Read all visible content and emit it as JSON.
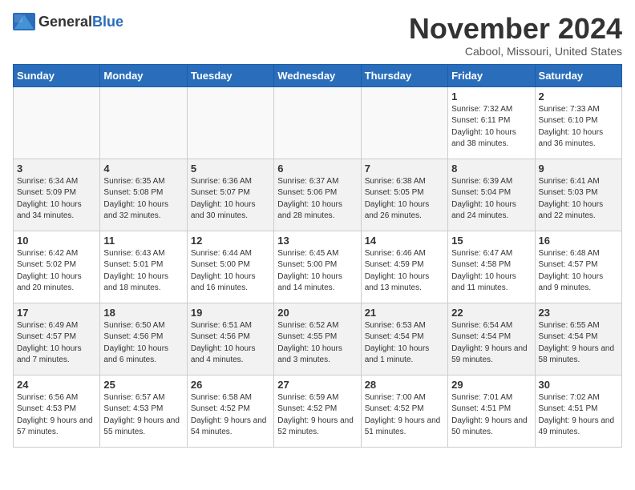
{
  "logo": {
    "text_general": "General",
    "text_blue": "Blue"
  },
  "header": {
    "month": "November 2024",
    "location": "Cabool, Missouri, United States"
  },
  "weekdays": [
    "Sunday",
    "Monday",
    "Tuesday",
    "Wednesday",
    "Thursday",
    "Friday",
    "Saturday"
  ],
  "weeks": [
    {
      "shaded": false,
      "days": [
        {
          "num": "",
          "info": ""
        },
        {
          "num": "",
          "info": ""
        },
        {
          "num": "",
          "info": ""
        },
        {
          "num": "",
          "info": ""
        },
        {
          "num": "",
          "info": ""
        },
        {
          "num": "1",
          "info": "Sunrise: 7:32 AM\nSunset: 6:11 PM\nDaylight: 10 hours and 38 minutes."
        },
        {
          "num": "2",
          "info": "Sunrise: 7:33 AM\nSunset: 6:10 PM\nDaylight: 10 hours and 36 minutes."
        }
      ]
    },
    {
      "shaded": true,
      "days": [
        {
          "num": "3",
          "info": "Sunrise: 6:34 AM\nSunset: 5:09 PM\nDaylight: 10 hours and 34 minutes."
        },
        {
          "num": "4",
          "info": "Sunrise: 6:35 AM\nSunset: 5:08 PM\nDaylight: 10 hours and 32 minutes."
        },
        {
          "num": "5",
          "info": "Sunrise: 6:36 AM\nSunset: 5:07 PM\nDaylight: 10 hours and 30 minutes."
        },
        {
          "num": "6",
          "info": "Sunrise: 6:37 AM\nSunset: 5:06 PM\nDaylight: 10 hours and 28 minutes."
        },
        {
          "num": "7",
          "info": "Sunrise: 6:38 AM\nSunset: 5:05 PM\nDaylight: 10 hours and 26 minutes."
        },
        {
          "num": "8",
          "info": "Sunrise: 6:39 AM\nSunset: 5:04 PM\nDaylight: 10 hours and 24 minutes."
        },
        {
          "num": "9",
          "info": "Sunrise: 6:41 AM\nSunset: 5:03 PM\nDaylight: 10 hours and 22 minutes."
        }
      ]
    },
    {
      "shaded": false,
      "days": [
        {
          "num": "10",
          "info": "Sunrise: 6:42 AM\nSunset: 5:02 PM\nDaylight: 10 hours and 20 minutes."
        },
        {
          "num": "11",
          "info": "Sunrise: 6:43 AM\nSunset: 5:01 PM\nDaylight: 10 hours and 18 minutes."
        },
        {
          "num": "12",
          "info": "Sunrise: 6:44 AM\nSunset: 5:00 PM\nDaylight: 10 hours and 16 minutes."
        },
        {
          "num": "13",
          "info": "Sunrise: 6:45 AM\nSunset: 5:00 PM\nDaylight: 10 hours and 14 minutes."
        },
        {
          "num": "14",
          "info": "Sunrise: 6:46 AM\nSunset: 4:59 PM\nDaylight: 10 hours and 13 minutes."
        },
        {
          "num": "15",
          "info": "Sunrise: 6:47 AM\nSunset: 4:58 PM\nDaylight: 10 hours and 11 minutes."
        },
        {
          "num": "16",
          "info": "Sunrise: 6:48 AM\nSunset: 4:57 PM\nDaylight: 10 hours and 9 minutes."
        }
      ]
    },
    {
      "shaded": true,
      "days": [
        {
          "num": "17",
          "info": "Sunrise: 6:49 AM\nSunset: 4:57 PM\nDaylight: 10 hours and 7 minutes."
        },
        {
          "num": "18",
          "info": "Sunrise: 6:50 AM\nSunset: 4:56 PM\nDaylight: 10 hours and 6 minutes."
        },
        {
          "num": "19",
          "info": "Sunrise: 6:51 AM\nSunset: 4:56 PM\nDaylight: 10 hours and 4 minutes."
        },
        {
          "num": "20",
          "info": "Sunrise: 6:52 AM\nSunset: 4:55 PM\nDaylight: 10 hours and 3 minutes."
        },
        {
          "num": "21",
          "info": "Sunrise: 6:53 AM\nSunset: 4:54 PM\nDaylight: 10 hours and 1 minute."
        },
        {
          "num": "22",
          "info": "Sunrise: 6:54 AM\nSunset: 4:54 PM\nDaylight: 9 hours and 59 minutes."
        },
        {
          "num": "23",
          "info": "Sunrise: 6:55 AM\nSunset: 4:54 PM\nDaylight: 9 hours and 58 minutes."
        }
      ]
    },
    {
      "shaded": false,
      "days": [
        {
          "num": "24",
          "info": "Sunrise: 6:56 AM\nSunset: 4:53 PM\nDaylight: 9 hours and 57 minutes."
        },
        {
          "num": "25",
          "info": "Sunrise: 6:57 AM\nSunset: 4:53 PM\nDaylight: 9 hours and 55 minutes."
        },
        {
          "num": "26",
          "info": "Sunrise: 6:58 AM\nSunset: 4:52 PM\nDaylight: 9 hours and 54 minutes."
        },
        {
          "num": "27",
          "info": "Sunrise: 6:59 AM\nSunset: 4:52 PM\nDaylight: 9 hours and 52 minutes."
        },
        {
          "num": "28",
          "info": "Sunrise: 7:00 AM\nSunset: 4:52 PM\nDaylight: 9 hours and 51 minutes."
        },
        {
          "num": "29",
          "info": "Sunrise: 7:01 AM\nSunset: 4:51 PM\nDaylight: 9 hours and 50 minutes."
        },
        {
          "num": "30",
          "info": "Sunrise: 7:02 AM\nSunset: 4:51 PM\nDaylight: 9 hours and 49 minutes."
        }
      ]
    }
  ]
}
